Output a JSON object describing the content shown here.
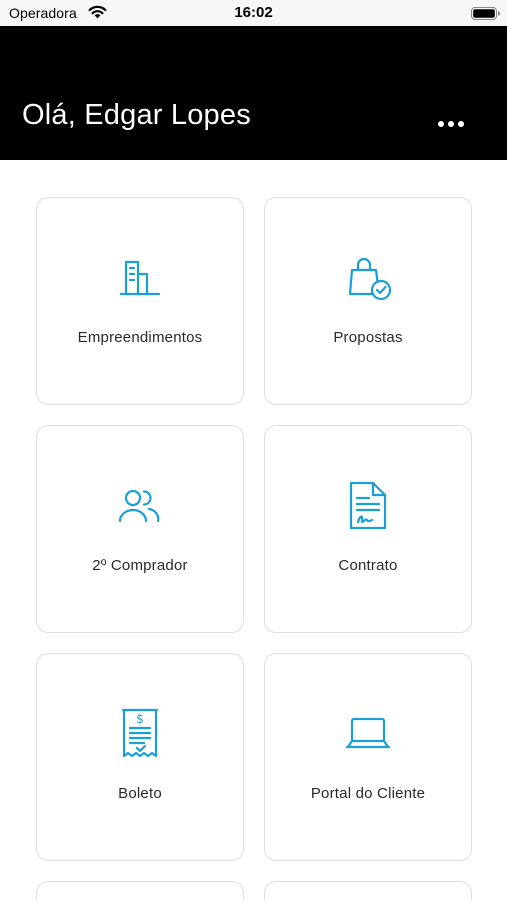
{
  "status_bar": {
    "carrier": "Operadora",
    "time": "16:02"
  },
  "header": {
    "greeting": "Olá, Edgar Lopes"
  },
  "menu": {
    "items": [
      {
        "label": "Empreendimentos",
        "icon": "building-icon"
      },
      {
        "label": "Propostas",
        "icon": "shopping-bag-check-icon"
      },
      {
        "label": "2º Comprador",
        "icon": "users-icon"
      },
      {
        "label": "Contrato",
        "icon": "signed-document-icon"
      },
      {
        "label": "Boleto",
        "icon": "receipt-dollar-icon"
      },
      {
        "label": "Portal do Cliente",
        "icon": "laptop-icon"
      }
    ]
  },
  "colors": {
    "accent": "#1a9fd6",
    "header_bg": "#000000",
    "card_border": "#dedede"
  }
}
